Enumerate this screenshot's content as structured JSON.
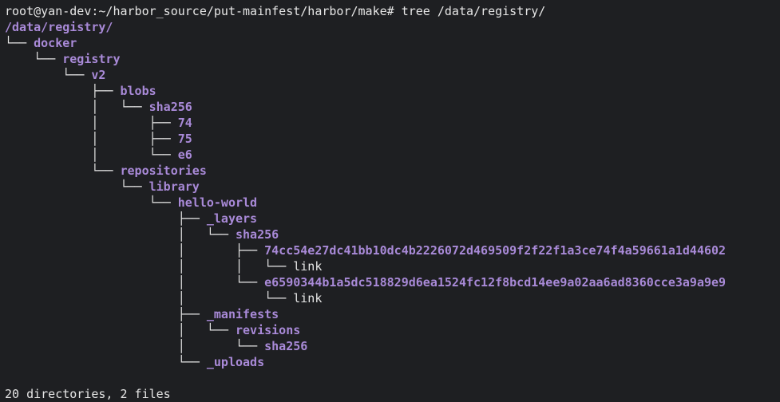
{
  "prompt": {
    "user_host": "root@yan-dev",
    "path": "~/harbor_source/put-mainfest/harbor/make",
    "symbol": "#",
    "command": "tree /data/registry/"
  },
  "tree": [
    {
      "prefix": "",
      "name": "/data/registry/",
      "type": "dir"
    },
    {
      "prefix": "└── ",
      "name": "docker",
      "type": "dir"
    },
    {
      "prefix": "    └── ",
      "name": "registry",
      "type": "dir"
    },
    {
      "prefix": "        └── ",
      "name": "v2",
      "type": "dir"
    },
    {
      "prefix": "            ├── ",
      "name": "blobs",
      "type": "dir"
    },
    {
      "prefix": "            │   └── ",
      "name": "sha256",
      "type": "dir"
    },
    {
      "prefix": "            │       ├── ",
      "name": "74",
      "type": "dir"
    },
    {
      "prefix": "            │       ├── ",
      "name": "75",
      "type": "dir"
    },
    {
      "prefix": "            │       └── ",
      "name": "e6",
      "type": "dir"
    },
    {
      "prefix": "            └── ",
      "name": "repositories",
      "type": "dir"
    },
    {
      "prefix": "                └── ",
      "name": "library",
      "type": "dir"
    },
    {
      "prefix": "                    └── ",
      "name": "hello-world",
      "type": "dir"
    },
    {
      "prefix": "                        ├── ",
      "name": "_layers",
      "type": "dir"
    },
    {
      "prefix": "                        │   └── ",
      "name": "sha256",
      "type": "dir"
    },
    {
      "prefix": "                        │       ├── ",
      "name": "74cc54e27dc41bb10dc4b2226072d469509f2f22f1a3ce74f4a59661a1d44602",
      "type": "dir"
    },
    {
      "prefix": "                        │       │   └── ",
      "name": "link",
      "type": "file"
    },
    {
      "prefix": "                        │       └── ",
      "name": "e6590344b1a5dc518829d6ea1524fc12f8bcd14ee9a02aa6ad8360cce3a9a9e9",
      "type": "dir"
    },
    {
      "prefix": "                        │           └── ",
      "name": "link",
      "type": "file"
    },
    {
      "prefix": "                        ├── ",
      "name": "_manifests",
      "type": "dir"
    },
    {
      "prefix": "                        │   └── ",
      "name": "revisions",
      "type": "dir"
    },
    {
      "prefix": "                        │       └── ",
      "name": "sha256",
      "type": "dir"
    },
    {
      "prefix": "                        └── ",
      "name": "_uploads",
      "type": "dir"
    }
  ],
  "summary": "20 directories, 2 files",
  "colors": {
    "background": "#1e1f22",
    "text": "#e6e6e6",
    "directory": "#a98ad8"
  }
}
